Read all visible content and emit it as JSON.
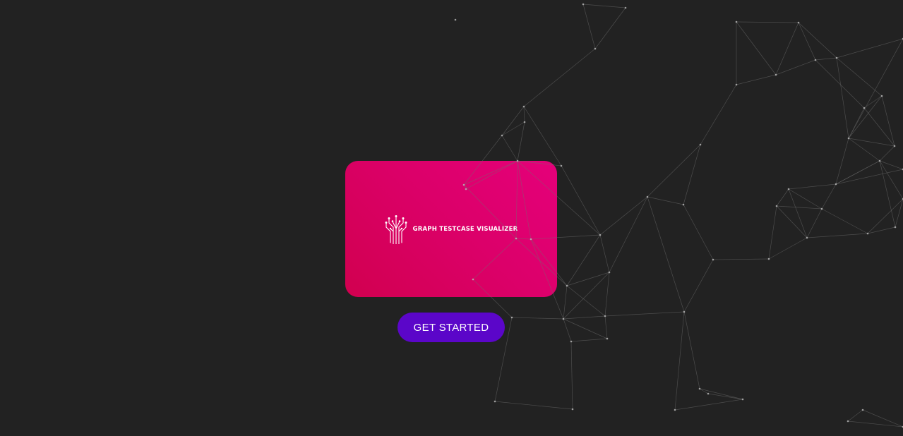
{
  "brand": {
    "name": "GRAPH TESTCASE VISUALIZER",
    "icon": "circuit-tree-icon",
    "card_color": "#dc006a",
    "text_color": "#ffffff"
  },
  "hero": {
    "cta_label": "GET STARTED",
    "cta_color": "#5b06c9"
  },
  "background": {
    "color": "#222222",
    "decoration": "network-graph",
    "line_color": "#6f6f6f"
  }
}
